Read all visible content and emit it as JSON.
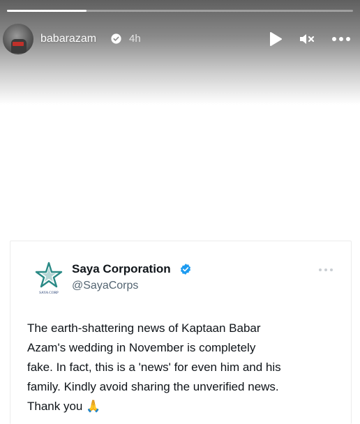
{
  "story": {
    "username": "babarazam",
    "time": "4h",
    "progress": 0.23,
    "icons": {
      "play": "play-icon",
      "mute": "mute-icon",
      "more": "more-icon",
      "verified": "verified-icon"
    }
  },
  "tweet": {
    "display_name": "Saya Corporation",
    "handle": "@SayaCorps",
    "logo_text": "SAYA CORP",
    "text": "The earth-shattering news of Kaptaan Babar\nAzam's wedding in November is completely\nfake. In fact, this is a 'news' for even him and his\nfamily. Kindly avoid sharing the unverified news.\nThank you 🙏",
    "colors": {
      "verified": "#1d9bf0",
      "logo_teal": "#2a8a86",
      "logo_navy": "#1f3a6e"
    }
  }
}
